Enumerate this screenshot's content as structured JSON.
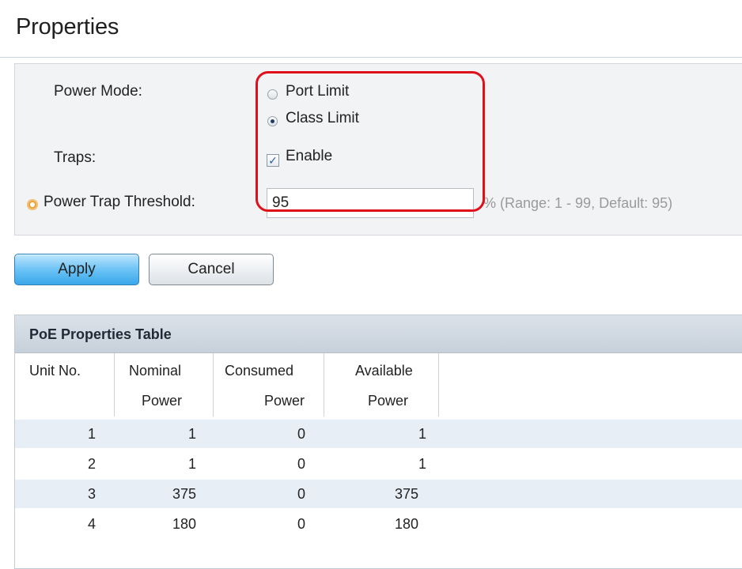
{
  "page": {
    "title": "Properties"
  },
  "form": {
    "power_mode_label": "Power Mode:",
    "power_mode_options": [
      {
        "label": "Port Limit",
        "checked": false
      },
      {
        "label": "Class Limit",
        "checked": true
      }
    ],
    "traps_label": "Traps:",
    "traps_enable_label": "Enable",
    "traps_enabled": true,
    "threshold_label": "Power Trap Threshold:",
    "threshold_value": "95",
    "threshold_hint": "% (Range: 1 - 99, Default: 95)"
  },
  "buttons": {
    "apply": "Apply",
    "cancel": "Cancel"
  },
  "table": {
    "caption": "PoE Properties Table",
    "headers": [
      [
        "Unit No.",
        ""
      ],
      [
        "Nominal",
        "Power"
      ],
      [
        "Consumed",
        "Power"
      ],
      [
        "Available",
        "Power"
      ]
    ],
    "rows": [
      [
        "1",
        "1",
        "0",
        "1"
      ],
      [
        "2",
        "1",
        "0",
        "1"
      ],
      [
        "3",
        "375",
        "0",
        "375"
      ],
      [
        "4",
        "180",
        "0",
        "180"
      ]
    ]
  },
  "colors": {
    "highlight": "#e0101a",
    "apply_button": "#3aa7ea",
    "required_indicator": "#e8a43a",
    "row_stripe": "#e8eef5"
  },
  "icons": {
    "required": "gear-icon"
  }
}
